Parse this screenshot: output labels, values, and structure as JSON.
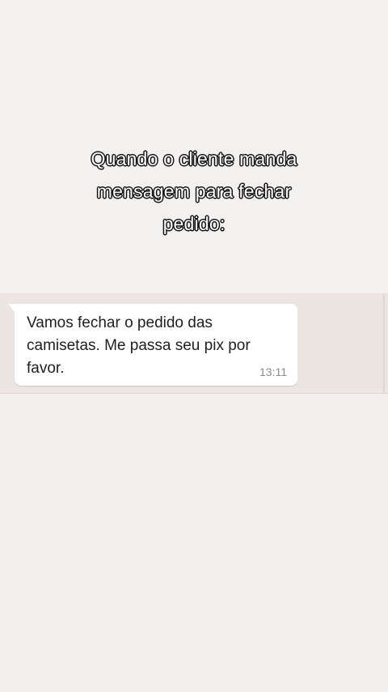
{
  "caption": {
    "lines": [
      "Quando o cliente manda",
      "mensagem para fechar",
      "pedido:"
    ]
  },
  "chat": {
    "message": {
      "text": "Vamos fechar o pedido das camisetas. Me passa seu pix por favor.",
      "time": "13:11"
    }
  }
}
